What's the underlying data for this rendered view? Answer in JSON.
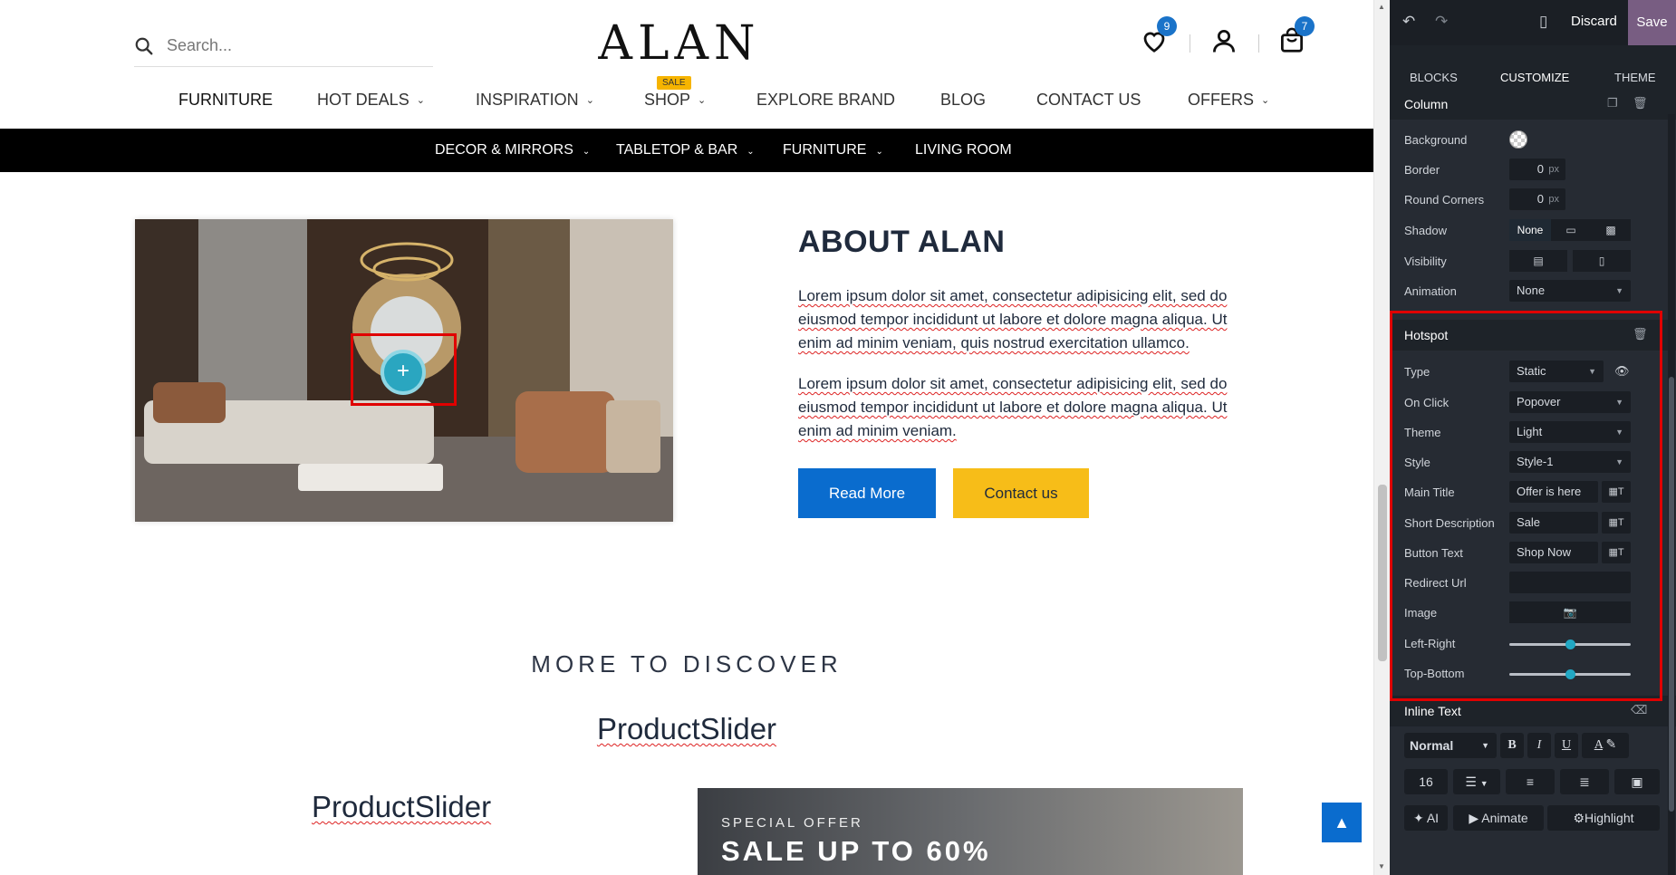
{
  "site": {
    "search_placeholder": "Search...",
    "logo": "ALAN",
    "wishlist_count": "9",
    "cart_count": "7",
    "main_nav": [
      {
        "label": "FURNITURE",
        "chevron": false
      },
      {
        "label": "HOT DEALS",
        "chevron": true
      },
      {
        "label": "INSPIRATION",
        "chevron": true
      },
      {
        "label": "SHOP",
        "chevron": true
      },
      {
        "label": "EXPLORE BRAND",
        "chevron": false
      },
      {
        "label": "BLOG",
        "chevron": false
      },
      {
        "label": "CONTACT US",
        "chevron": false
      },
      {
        "label": "OFFERS",
        "chevron": true
      }
    ],
    "shop_badge": "SALE",
    "sub_nav": [
      {
        "label": "DECOR & MIRRORS",
        "chevron": true
      },
      {
        "label": "TABLETOP & BAR",
        "chevron": true
      },
      {
        "label": "FURNITURE",
        "chevron": true
      },
      {
        "label": "LIVING ROOM",
        "chevron": false
      }
    ],
    "about_title": "ABOUT ALAN",
    "about_p1": "Lorem ipsum dolor sit amet, consectetur adipisicing elit, sed do eiusmod tempor incididunt ut labore et dolore magna aliqua. Ut enim ad minim veniam, quis nostrud exercitation ullamco.",
    "about_p2": "Lorem ipsum dolor sit amet, consectetur adipisicing elit, sed do eiusmod tempor incididunt ut labore et dolore magna aliqua. Ut enim ad minim veniam.",
    "read_more": "Read More",
    "contact_us": "Contact us",
    "discover_title": "MORE TO DISCOVER",
    "product_slider_1": "ProductSlider",
    "product_slider_2": "ProductSlider",
    "promo_kicker": "SPECIAL OFFER",
    "promo_headline": "SALE UP TO 60%"
  },
  "panel": {
    "discard": "Discard",
    "save": "Save",
    "tabs": [
      "BLOCKS",
      "CUSTOMIZE",
      "THEME"
    ],
    "active_tab": "CUSTOMIZE",
    "column": {
      "title": "Column",
      "background_label": "Background",
      "border_label": "Border",
      "border_value": "0",
      "round_label": "Round Corners",
      "round_value": "0",
      "unit": "px",
      "shadow_label": "Shadow",
      "shadow_value": "None",
      "visibility_label": "Visibility",
      "animation_label": "Animation",
      "animation_value": "None"
    },
    "hotspot": {
      "title": "Hotspot",
      "type_label": "Type",
      "type_value": "Static",
      "onclick_label": "On Click",
      "onclick_value": "Popover",
      "theme_label": "Theme",
      "theme_value": "Light",
      "style_label": "Style",
      "style_value": "Style-1",
      "main_title_label": "Main Title",
      "main_title_value": "Offer is here",
      "short_desc_label": "Short Description",
      "short_desc_value": "Sale",
      "button_text_label": "Button Text",
      "button_text_value": "Shop Now",
      "redirect_label": "Redirect Url",
      "redirect_value": "",
      "image_label": "Image",
      "left_right_label": "Left-Right",
      "left_right_level": 0.5,
      "top_bottom_label": "Top-Bottom",
      "top_bottom_level": 0.5
    },
    "inline_text": {
      "title": "Inline Text",
      "format_value": "Normal",
      "font_size": "16",
      "ai_label": "AI",
      "animate_label": "Animate",
      "highlight_label": "Highlight"
    }
  },
  "colors": {
    "primary_blue": "#0a6cce",
    "accent_yellow": "#f7bd18",
    "panel_bg": "#262b33",
    "save_purple": "#785d82",
    "highlight_red": "#e00000",
    "teal": "#22a8c4"
  }
}
